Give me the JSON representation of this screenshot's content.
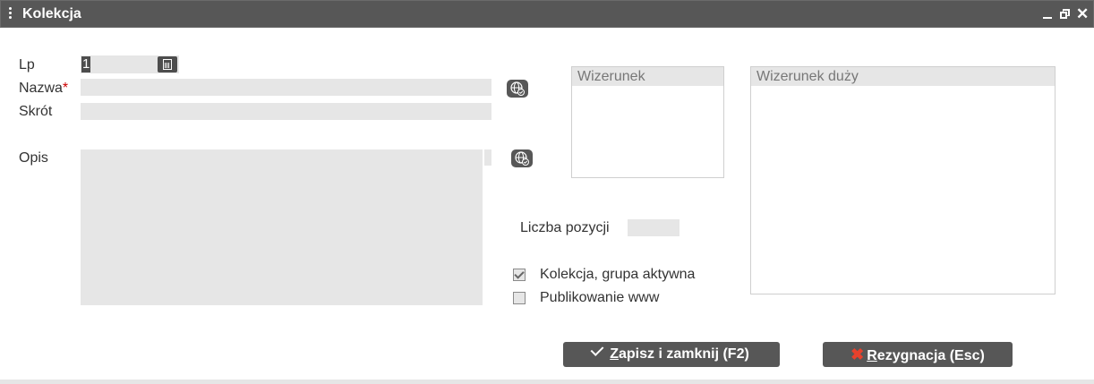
{
  "window": {
    "title": "Kolekcja"
  },
  "form": {
    "lp_label": "Lp",
    "lp_value": "1",
    "name_label": "Nazwa",
    "name_required": "*",
    "name_value": "",
    "short_label": "Skrót",
    "short_value": "",
    "desc_label": "Opis",
    "desc_value": "",
    "count_label": "Liczba pozycji",
    "count_value": ""
  },
  "images": {
    "small_label": "Wizerunek",
    "large_label": "Wizerunek duży"
  },
  "checkboxes": [
    {
      "label": "Kolekcja, grupa aktywna",
      "checked": true
    },
    {
      "label": "Publikowanie www",
      "checked": false
    }
  ],
  "buttons": {
    "save_hotkey": "Z",
    "save_rest": "apisz i zamknij (F2)",
    "cancel_hotkey": "R",
    "cancel_rest": "ezygnacja (Esc)"
  },
  "icons": {
    "calc": "calculator-icon",
    "globe": "globe-translate-icon",
    "save": "check-icon",
    "cancel": "x-icon"
  },
  "colors": {
    "titlebar": "#575757",
    "field": "#e6e6e6",
    "button": "#575757",
    "cancel_x": "#e8412c",
    "required": "#cc0000"
  }
}
